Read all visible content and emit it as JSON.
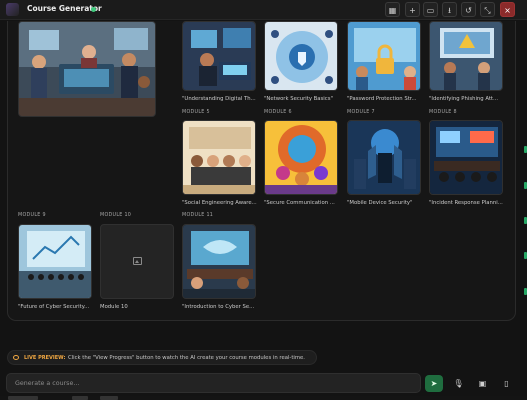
{
  "app": {
    "title": "Course Generator",
    "status_color": "#3fc97c"
  },
  "toolbar": {
    "icons": [
      "grid-icon",
      "plus-icon",
      "chat-icon",
      "download-icon",
      "history-icon",
      "collapse-icon",
      "close-icon"
    ]
  },
  "modules": [
    {
      "label": "",
      "caption": "",
      "art": "team"
    },
    {
      "label": "",
      "caption": "\"Understanding Digital Th...",
      "art": "hacker"
    },
    {
      "label": "",
      "caption": "\"Network Security Basics\"",
      "art": "network"
    },
    {
      "label": "",
      "caption": "\"Password Protection Str...",
      "art": "password"
    },
    {
      "label": "",
      "caption": "\"Identifying Phishing Att...",
      "art": "phishing"
    },
    {
      "label": "MODULE 5",
      "caption": "\"Social Engineering Aware...",
      "art": "social"
    },
    {
      "label": "MODULE 6",
      "caption": "\"Secure Communication ...",
      "art": "secure"
    },
    {
      "label": "MODULE 7",
      "caption": "\"Mobile Device Security\"",
      "art": "mobile"
    },
    {
      "label": "MODULE 8",
      "caption": "\"Incident Response Planni...",
      "art": "incident"
    },
    {
      "label": "MODULE 9",
      "caption": "\"Future of Cyber Security...",
      "art": "future"
    },
    {
      "label": "MODULE 10",
      "caption": "Module 10",
      "art": "empty"
    },
    {
      "label": "MODULE 11",
      "caption": "\"Introduction to Cyber Se...",
      "art": "intro"
    }
  ],
  "preview": {
    "tag": "LIVE PREVIEW:",
    "text": "Click the \"View Progress\" button to watch the AI create your course modules in real-time."
  },
  "input": {
    "placeholder": "Generate a course...",
    "value": ""
  },
  "input_tools": [
    "send-icon",
    "microphone-icon",
    "image-icon",
    "book-icon"
  ],
  "accent": {
    "green": "#1f6d3f",
    "warning": "#f0a742"
  }
}
